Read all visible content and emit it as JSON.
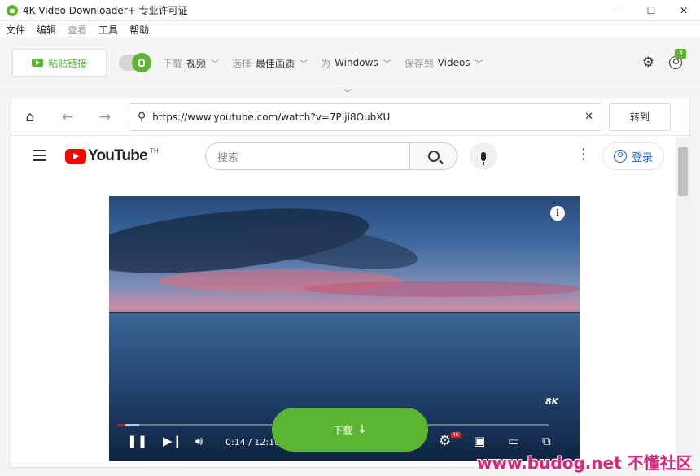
{
  "window": {
    "title": "4K Video Downloader+ 专业许可证",
    "controls": {
      "minimize": "—",
      "maximize": "☐",
      "close": "✕"
    }
  },
  "menu": {
    "items": [
      {
        "label": "文件",
        "enabled": true
      },
      {
        "label": "编辑",
        "enabled": true
      },
      {
        "label": "查看",
        "enabled": false
      },
      {
        "label": "工具",
        "enabled": true
      },
      {
        "label": "帮助",
        "enabled": true
      }
    ]
  },
  "toolbar": {
    "paste_label": "粘贴链接",
    "smart_mode_on": true,
    "download_label": "下载",
    "download_value": "视频",
    "select_label": "选择",
    "select_value": "最佳画质",
    "for_label": "为",
    "for_value": "Windows",
    "saveto_label": "保存到",
    "saveto_value": "Videos",
    "badge_count": "3"
  },
  "browser": {
    "url": "https://www.youtube.com/watch?v=7PIji8OubXU",
    "go_label": "转到",
    "icons": [
      "home-icon",
      "back-arrow-icon",
      "forward-arrow-icon",
      "search-icon",
      "clear-icon"
    ]
  },
  "youtube": {
    "logo_text": "YouTube",
    "country": "TH",
    "search_placeholder": "搜索",
    "signin_label": "登录"
  },
  "video": {
    "current_time": "0:14 / 12:16",
    "watermark": "8K",
    "quality_badge": "4K",
    "progress_fraction": 0.019,
    "buffer_fraction": 0.05
  },
  "download_button": {
    "label": "下载",
    "arrow": "↓"
  },
  "site_watermark": "www.budog.net 不懂社区",
  "colors": {
    "accent": "#5cb531",
    "youtube_red": "#ff0000",
    "link_blue": "#0f63d4"
  }
}
